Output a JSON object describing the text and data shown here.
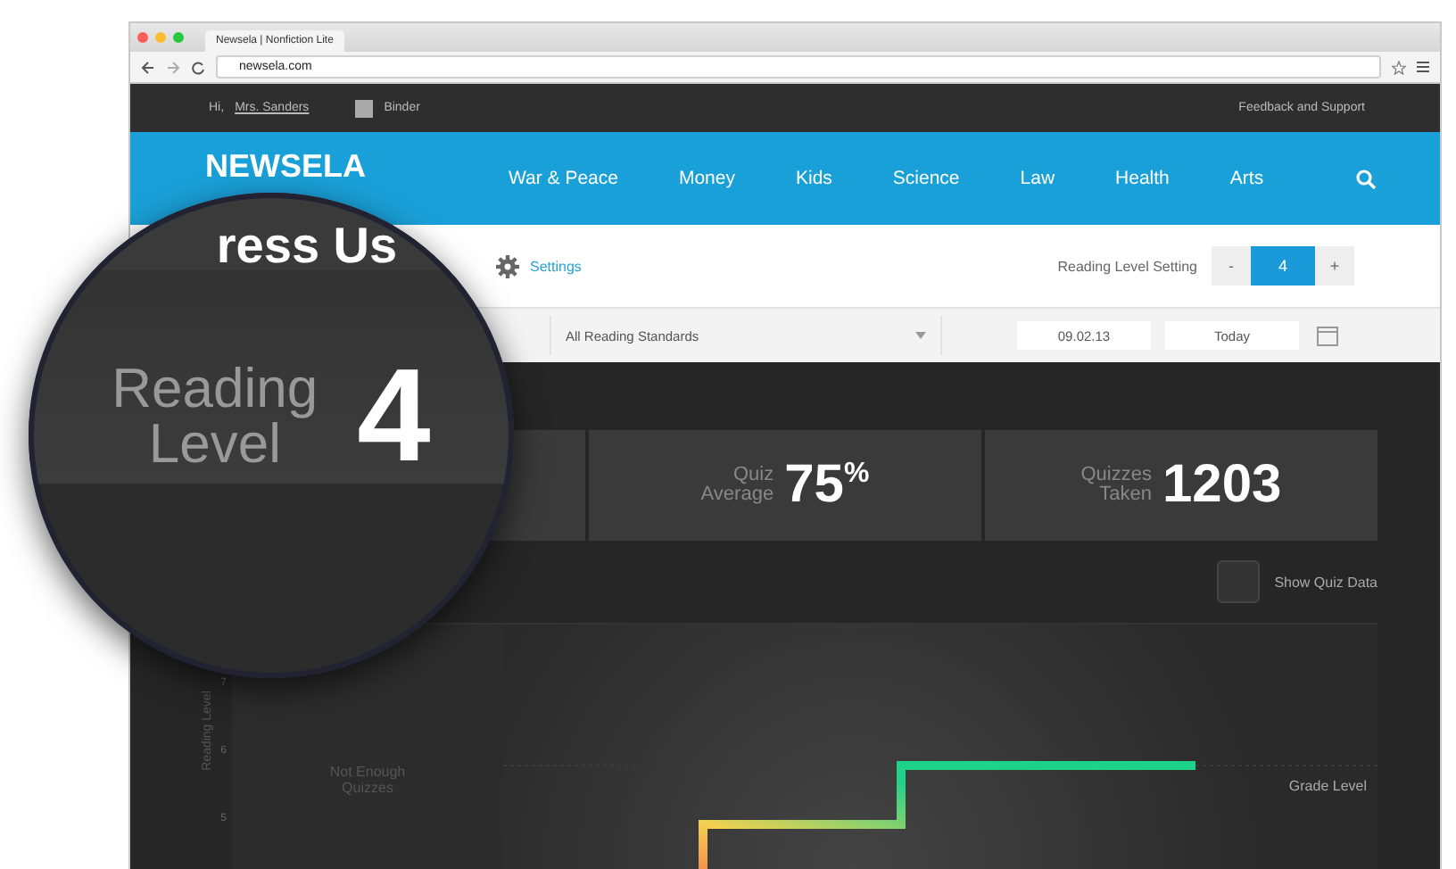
{
  "browser": {
    "tab_title": "Newsela | Nonfiction Lite",
    "url": "newsela.com"
  },
  "top_bar": {
    "greeting": "Hi,",
    "user": "Mrs. Sanders",
    "binder": "Binder",
    "support": "Feedback and Support"
  },
  "nav": {
    "logo": "NEWSELA",
    "items": [
      "War & Peace",
      "Money",
      "Kids",
      "Science",
      "Law",
      "Health",
      "Arts"
    ]
  },
  "settings_bar": {
    "settings": "Settings",
    "level_label": "Reading Level Setting",
    "decrement": "-",
    "level_value": "4",
    "increment": "+"
  },
  "filters": {
    "standards": "All Reading Standards",
    "start_date": "09.02.13",
    "end_date": "Today"
  },
  "stats": [
    {
      "label_lines": [
        "Quiz",
        "Average"
      ],
      "value": "75",
      "unit": "%"
    },
    {
      "label_lines": [
        "Quizzes",
        "Taken"
      ],
      "value": "1203"
    }
  ],
  "quiz_toggle": {
    "label": "Show Quiz Data",
    "checked": false
  },
  "chart": {
    "ylabel": "Reading Level",
    "yticks": [
      "7",
      "6",
      "5"
    ],
    "note": "Not Enough Quizzes",
    "reference_label": "Grade Level"
  },
  "magnifier": {
    "heading_fragment": "ress Us",
    "label_lines": [
      "Reading",
      "Level"
    ],
    "value": "4"
  }
}
